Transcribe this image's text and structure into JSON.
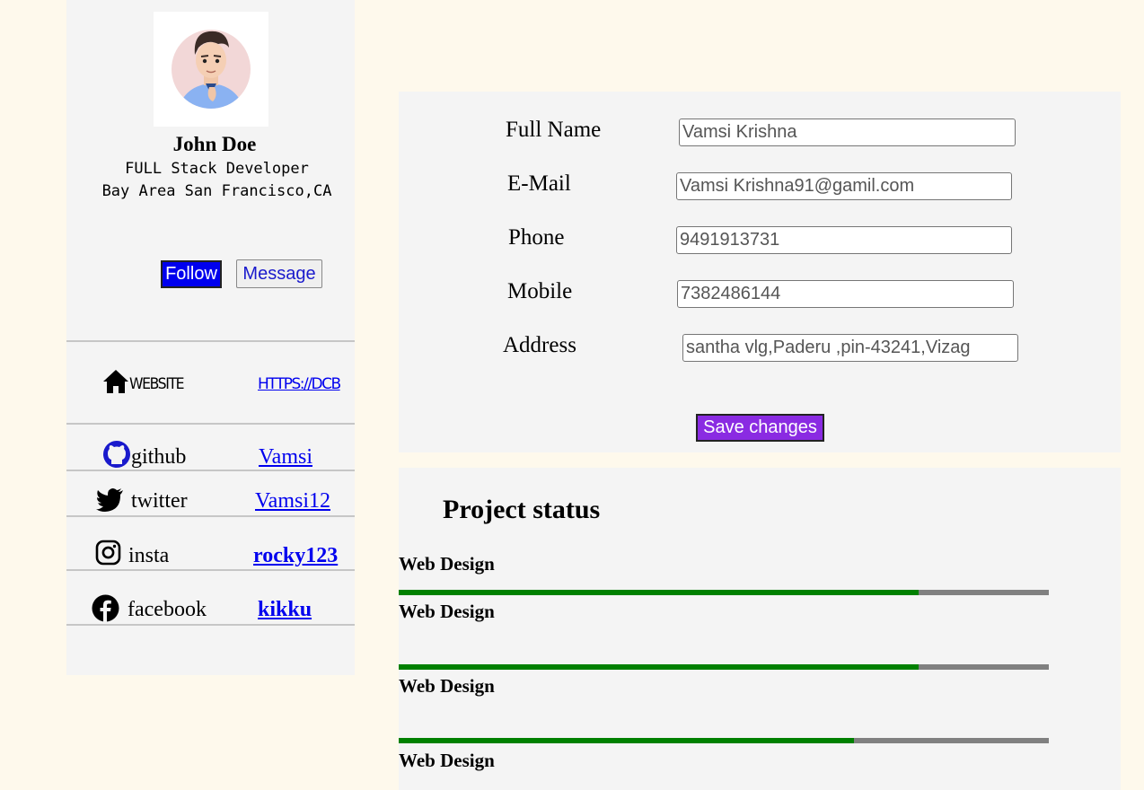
{
  "profile": {
    "name": "John Doe",
    "role": "FULL Stack Developer",
    "location": "Bay Area San Francisco,CA",
    "follow_label": "Follow",
    "message_label": "Message"
  },
  "links": {
    "website": {
      "icon": "home-icon",
      "label": "WEBSITE",
      "value": "HTTPS://DCB"
    },
    "github": {
      "icon": "github-icon",
      "label": "github",
      "value": "Vamsi"
    },
    "twitter": {
      "icon": "twitter-icon",
      "label": "twitter",
      "value": "Vamsi12"
    },
    "insta": {
      "icon": "instagram-icon",
      "label": "insta",
      "value": "rocky123"
    },
    "facebook": {
      "icon": "facebook-icon",
      "label": "facebook",
      "value": "kikku"
    }
  },
  "form": {
    "fields": [
      {
        "label": "Full Name",
        "value": "Vamsi Krishna"
      },
      {
        "label": "E-Mail",
        "value": "Vamsi Krishna91@gamil.com"
      },
      {
        "label": "Phone",
        "value": "9491913731"
      },
      {
        "label": "Mobile",
        "value": "7382486144"
      },
      {
        "label": "Address",
        "value": "santha vlg,Paderu ,pin-43241,Vizag"
      }
    ],
    "save_label": "Save changes"
  },
  "project_status": {
    "title": "Project status",
    "items": [
      {
        "label": "Web Design",
        "progress": 0.8
      },
      {
        "label": "Web Design",
        "progress": 0.8
      },
      {
        "label": "Web Design",
        "progress": 0.7
      },
      {
        "label": "Web Design",
        "progress": null
      }
    ]
  },
  "colors": {
    "page_bg": "#fef9ec",
    "panel_bg": "#f4f4f4",
    "follow_bg": "#0000ee",
    "save_bg": "#8a2be2",
    "progress_fill": "#008000",
    "progress_track": "#808080",
    "link": "#0000ee"
  }
}
